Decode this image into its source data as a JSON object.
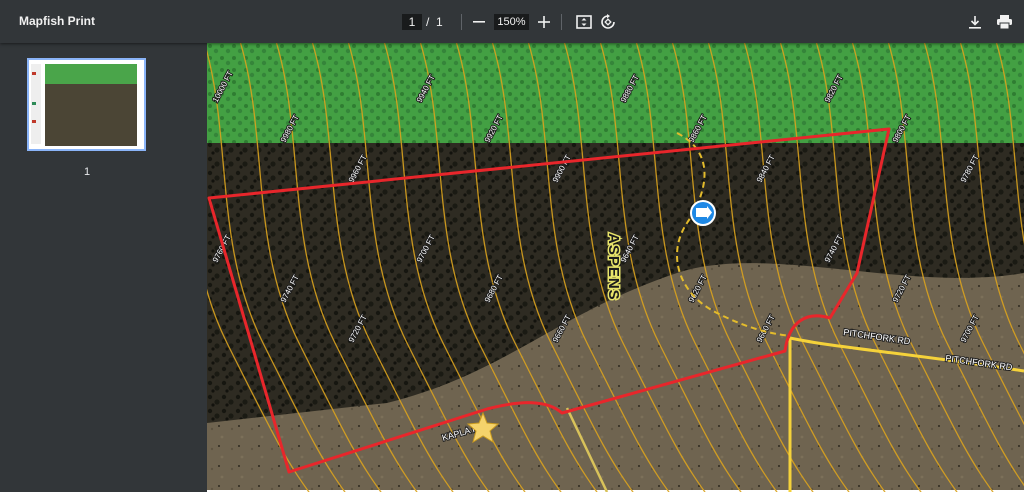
{
  "toolbar": {
    "title": "Mapfish Print",
    "current_page": "1",
    "separator": "/",
    "total_pages": "1",
    "zoom": "150%",
    "icons": {
      "zoom_out": "minus-icon",
      "zoom_in": "plus-icon",
      "fit": "fit-page-icon",
      "rotate": "rotate-icon",
      "download": "download-icon",
      "print": "print-icon"
    }
  },
  "sidebar": {
    "thumbnail_page": "1"
  },
  "map": {
    "colors": {
      "boundary": "#e8262b",
      "contour": "#d9a21e",
      "forest": "#3d9a3c",
      "road": "#f5d23a"
    },
    "area_label": "ASPENS",
    "roads": [
      "PITCHFORK RD",
      "PITCHFORK RD",
      "KAPLA RD"
    ],
    "contours": [
      "10000 FT",
      "9980 FT",
      "9960 FT",
      "9940 FT",
      "9920 FT",
      "9900 FT",
      "9880 FT",
      "9860 FT",
      "9840 FT",
      "9820 FT",
      "9800 FT",
      "9780 FT",
      "9760 FT",
      "9740 FT",
      "9720 FT",
      "9700 FT",
      "9680 FT",
      "9660 FT",
      "9640 FT",
      "9620 FT",
      "9600 FT"
    ],
    "contour_labels": [
      {
        "text": "10000 FT"
      },
      {
        "text": "9980 FT"
      },
      {
        "text": "9960 FT"
      },
      {
        "text": "9940 FT"
      },
      {
        "text": "9920 FT"
      },
      {
        "text": "9900 FT"
      },
      {
        "text": "9880 FT"
      },
      {
        "text": "9860 FT"
      },
      {
        "text": "9840 FT"
      },
      {
        "text": "9820 FT"
      },
      {
        "text": "9800 FT"
      },
      {
        "text": "9780 FT"
      },
      {
        "text": "9760 FT"
      },
      {
        "text": "9740 FT"
      },
      {
        "text": "9720 FT"
      },
      {
        "text": "9700 FT"
      },
      {
        "text": "9680 FT"
      },
      {
        "text": "9660 FT"
      },
      {
        "text": "9640 FT"
      },
      {
        "text": "9620 FT"
      },
      {
        "text": "9600 FT"
      },
      {
        "text": "9740 FT"
      },
      {
        "text": "9720 FT"
      },
      {
        "text": "9700 FT"
      }
    ]
  }
}
